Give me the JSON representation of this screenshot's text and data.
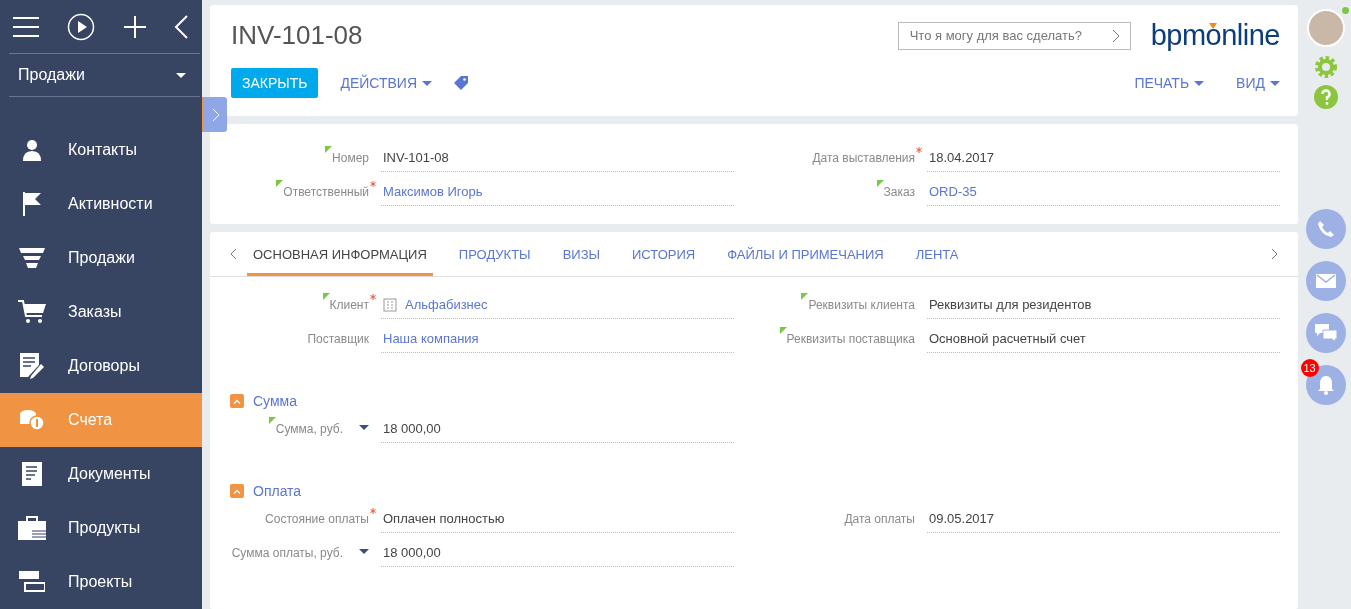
{
  "sidebar": {
    "workspace": "Продажи",
    "items": [
      {
        "label": "Контакты",
        "selected": false
      },
      {
        "label": "Активности",
        "selected": false
      },
      {
        "label": "Продажи",
        "selected": false
      },
      {
        "label": "Заказы",
        "selected": false
      },
      {
        "label": "Договоры",
        "selected": false
      },
      {
        "label": "Счета",
        "selected": true
      },
      {
        "label": "Документы",
        "selected": false
      },
      {
        "label": "Продукты",
        "selected": false
      },
      {
        "label": "Проекты",
        "selected": false
      }
    ]
  },
  "header": {
    "title": "INV-101-08",
    "search": {
      "placeholder": "Что я могу для вас сделать?"
    },
    "logo": "bpmonline",
    "actions": [
      {
        "label": "ЗАКРЫТЬ",
        "kind": "primary"
      },
      {
        "label": "ДЕЙСТВИЯ",
        "kind": "menu"
      },
      {
        "kind": "tag"
      }
    ],
    "right_actions": [
      {
        "label": "ПЕЧАТЬ",
        "kind": "menu"
      },
      {
        "label": "ВИД",
        "kind": "menu"
      }
    ]
  },
  "summary": {
    "left": [
      {
        "label": "Номер",
        "value": "INV-101-08",
        "kind": "text",
        "hint_marker": true,
        "required": false,
        "currency_menu": false
      },
      {
        "label": "Ответственный",
        "value": "Максимов Игорь",
        "kind": "link",
        "hint_marker": true,
        "required": true,
        "currency_menu": false
      }
    ],
    "right": [
      {
        "label": "Дата выставления",
        "value": "18.04.2017",
        "kind": "text",
        "hint_marker": false,
        "required": true,
        "currency_menu": false
      },
      {
        "label": "Заказ",
        "value": "ORD-35",
        "kind": "link",
        "hint_marker": true,
        "required": false,
        "currency_menu": false
      }
    ]
  },
  "tabs": [
    {
      "label": "ОСНОВНАЯ ИНФОРМАЦИЯ",
      "selected": true
    },
    {
      "label": "ПРОДУКТЫ",
      "selected": false
    },
    {
      "label": "ВИЗЫ",
      "selected": false
    },
    {
      "label": "ИСТОРИЯ",
      "selected": false
    },
    {
      "label": "ФАЙЛЫ И ПРИМЕЧАНИЯ",
      "selected": false
    },
    {
      "label": "ЛЕНТА",
      "selected": false
    }
  ],
  "main": {
    "left": [
      {
        "label": "Клиент",
        "value": "Альфабизнес",
        "kind": "account",
        "hint_marker": true,
        "required": true,
        "currency_menu": false
      },
      {
        "label": "Поставщик",
        "value": "Наша компания",
        "kind": "link",
        "hint_marker": false,
        "required": false,
        "currency_menu": false
      }
    ],
    "right": [
      {
        "label": "Реквизиты клиента",
        "value": "Реквизиты для резидентов",
        "kind": "text",
        "hint_marker": true,
        "required": false,
        "currency_menu": false
      },
      {
        "label": "Реквизиты поставщика",
        "value": "Основной расчетный счет",
        "kind": "text",
        "hint_marker": true,
        "required": false,
        "currency_menu": false
      }
    ]
  },
  "sections": [
    {
      "title": "Сумма",
      "expanded": true,
      "left": [
        {
          "label": "Сумма, руб.",
          "value": "18 000,00",
          "kind": "text",
          "hint_marker": true,
          "required": false,
          "currency_menu": true
        }
      ]
    },
    {
      "title": "Оплата",
      "expanded": true,
      "left": [
        {
          "label": "Состояние оплаты",
          "value": "Оплачен полностью",
          "kind": "text",
          "hint_marker": false,
          "required": true,
          "currency_menu": false
        },
        {
          "label": "Сумма оплаты, руб.",
          "value": "18 000,00",
          "kind": "text",
          "hint_marker": false,
          "required": false,
          "currency_menu": true
        }
      ],
      "right": [
        {
          "label": "Дата оплаты",
          "value": "09.05.2017",
          "kind": "text",
          "hint_marker": false,
          "required": false,
          "currency_menu": false
        }
      ]
    }
  ],
  "rail": {
    "notifications": "13"
  }
}
